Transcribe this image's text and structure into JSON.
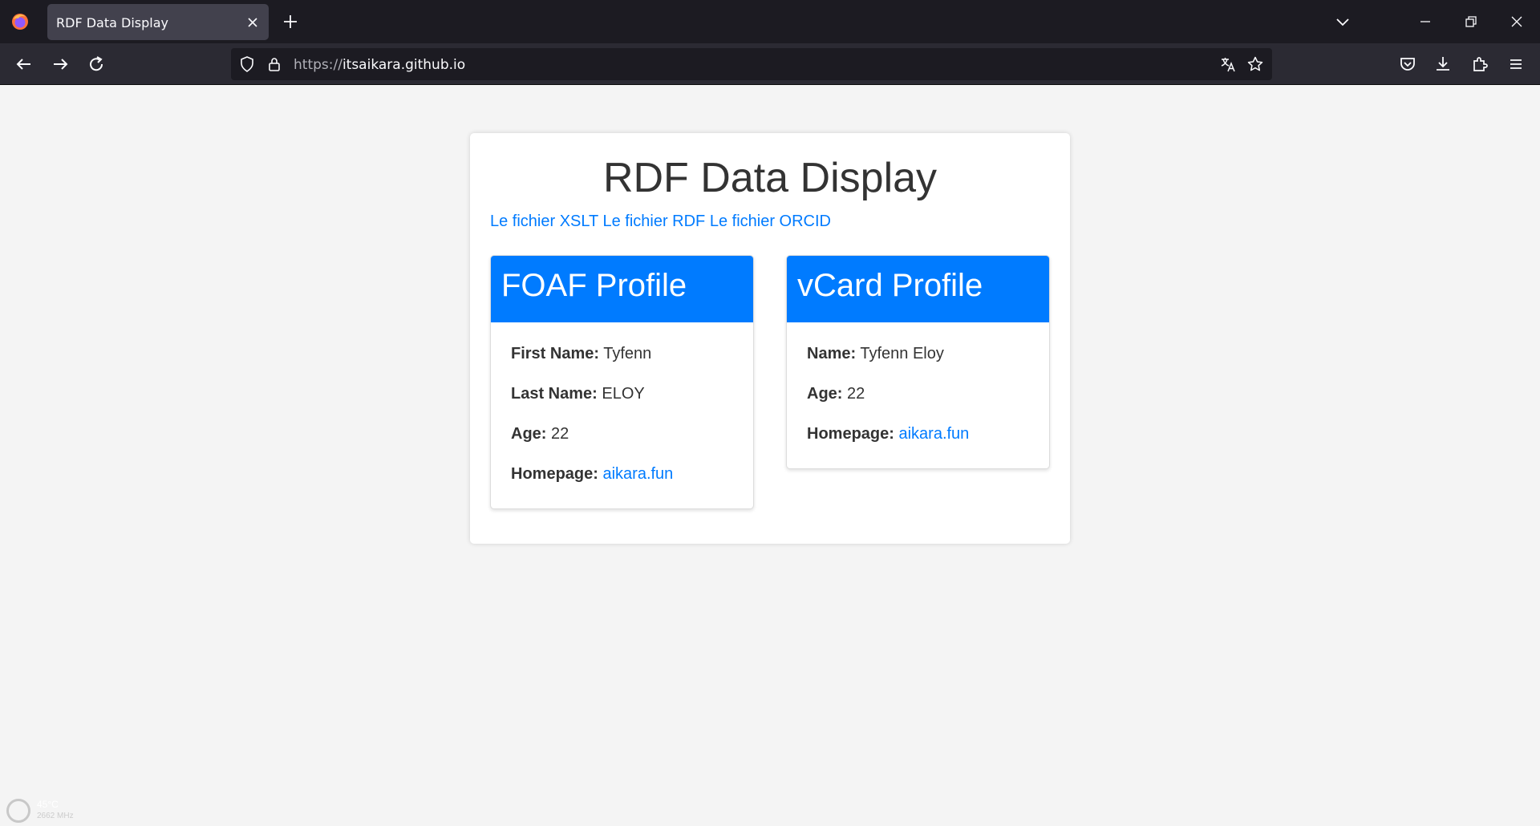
{
  "browser": {
    "tab_title": "RDF Data Display",
    "url_scheme": "https://",
    "url_host": "itsaikara.github.io"
  },
  "page": {
    "title": "RDF Data Display",
    "links": [
      {
        "label": "Le fichier XSLT"
      },
      {
        "label": "Le fichier RDF"
      },
      {
        "label": "Le fichier ORCID"
      }
    ],
    "accent_color": "#007bff"
  },
  "foaf": {
    "heading": "FOAF Profile",
    "first_name_label": "First Name:",
    "first_name": "Tyfenn",
    "last_name_label": "Last Name:",
    "last_name": "ELOY",
    "age_label": "Age:",
    "age": "22",
    "homepage_label": "Homepage:",
    "homepage": "aikara.fun"
  },
  "vcard": {
    "heading": "vCard Profile",
    "name_label": "Name:",
    "name": "Tyfenn Eloy",
    "age_label": "Age:",
    "age": "22",
    "homepage_label": "Homepage:",
    "homepage": "aikara.fun"
  },
  "widget": {
    "temp": "45°C",
    "freq": "2662 MHz"
  }
}
